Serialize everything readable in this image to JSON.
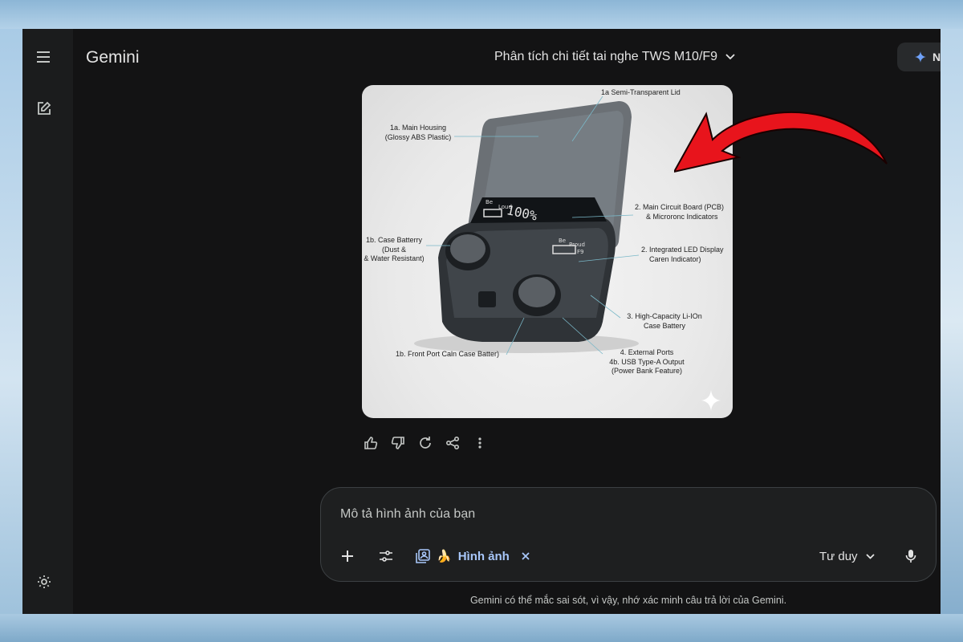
{
  "app": {
    "title": "Gemini"
  },
  "conversation": {
    "title": "Phân tích chi tiết tai nghe TWS M10/F9"
  },
  "header": {
    "upgrade_label": "N"
  },
  "image": {
    "callouts": {
      "lid": "1a Semi-Transparent Lid",
      "housing_1": "1a. Main Housing",
      "housing_2": "(Glossy ABS Plastic)",
      "pcb_1": "2. Main Circuit Board (PCB)",
      "pcb_2": "& Microronc Indicators",
      "battery_1": "1b. Case Batterry",
      "battery_2": "(Dust &",
      "battery_3": "& Water Resistant)",
      "led_1": "2. Integrated LED Display",
      "led_2": "Caren Indicator)",
      "liion_1": "3. High-Capacity Li-IOn",
      "liion_2": "Case Battery",
      "front_port": "1b. Front Port Caln Case Batter)",
      "ports_1": "4. External Ports",
      "ports_2": "4b. USB Type-A Output",
      "ports_3": "(Power Bank Feature)"
    },
    "display": {
      "left_brand_1": "Be",
      "left_brand_2": "Loud",
      "percent": "100%",
      "right_brand_1": "Be",
      "right_brand_2": "Proud",
      "model": "F9"
    }
  },
  "composer": {
    "placeholder": "Mô tả hình ảnh của bạn",
    "image_chip_label": "Hình ảnh",
    "image_chip_emoji": "🍌",
    "mode_label": "Tư duy"
  },
  "disclaimer": "Gemini có thể mắc sai sót, vì vậy, nhớ xác minh câu trả lời của Gemini.",
  "colors": {
    "accent": "#a8c7fa",
    "background": "#131314",
    "arrow": "#e8141c"
  }
}
